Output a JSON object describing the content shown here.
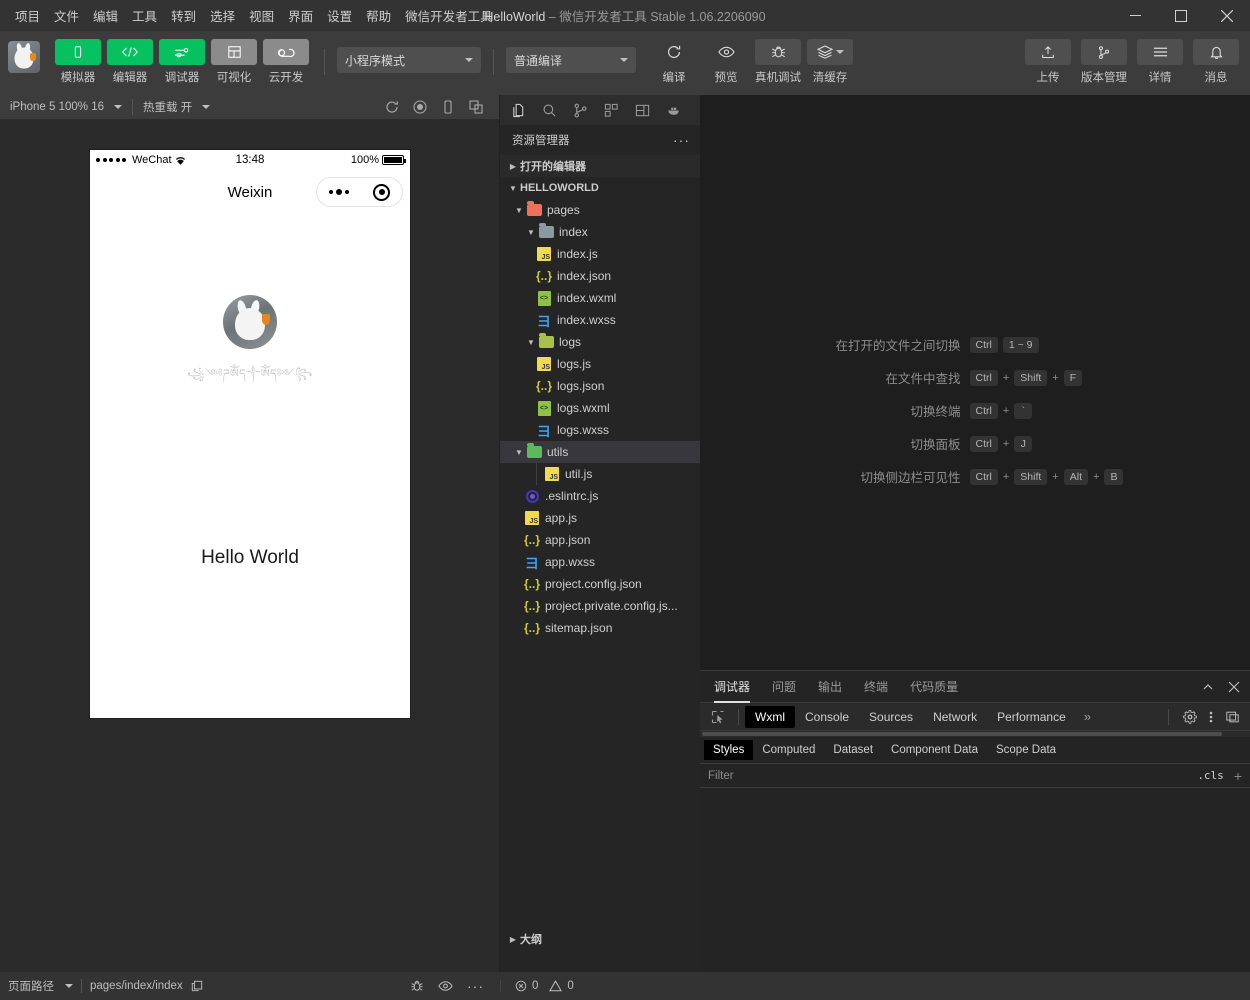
{
  "window": {
    "title": "HelloWorld",
    "dash": "–",
    "subtitle": "微信开发者工具 Stable 1.06.2206090",
    "minimize_icon": "minimize-icon",
    "maximize_icon": "maximize-icon",
    "close_icon": "close-icon"
  },
  "menu": [
    "项目",
    "文件",
    "编辑",
    "工具",
    "转到",
    "选择",
    "视图",
    "界面",
    "设置",
    "帮助",
    "微信开发者工具"
  ],
  "toolbar": {
    "avatar_name": "project-avatar",
    "modes": [
      {
        "label": "模拟器",
        "icon": "phone-icon",
        "active": true
      },
      {
        "label": "编辑器",
        "icon": "code-icon",
        "active": true
      },
      {
        "label": "调试器",
        "icon": "sliders-icon",
        "active": true
      },
      {
        "label": "可视化",
        "icon": "layout-icon",
        "active": false
      },
      {
        "label": "云开发",
        "icon": "cloud-icon",
        "active": false
      }
    ],
    "project_mode": "小程序模式",
    "compile_mode": "普通编译",
    "actions": [
      {
        "label": "编译",
        "icon": "refresh-icon"
      },
      {
        "label": "预览",
        "icon": "eye-icon"
      },
      {
        "label": "真机调试",
        "icon": "bug-icon"
      },
      {
        "label": "清缓存",
        "icon": "layers-icon"
      }
    ],
    "right_actions": [
      {
        "label": "上传",
        "icon": "upload-icon"
      },
      {
        "label": "版本管理",
        "icon": "branch-icon"
      },
      {
        "label": "详情",
        "icon": "menu-icon"
      },
      {
        "label": "消息",
        "icon": "bell-icon"
      }
    ]
  },
  "simulator": {
    "device": "iPhone 5 100% 16",
    "hot_reload": "热重载 开",
    "icons": [
      "refresh-icon",
      "record-icon",
      "rotate-icon",
      "multi-window-icon"
    ],
    "phone": {
      "carrier": "WeChat",
      "time": "13:48",
      "battery_pct": "100%",
      "nav_title": "Weixin",
      "capsule_more_icon": "more-dots-icon",
      "capsule_target_icon": "target-icon",
      "user_name": "꧁༺ཌༀད༒ༀད༻꧂",
      "hello_text": "Hello World"
    }
  },
  "activity_bar": [
    {
      "name": "files-icon",
      "active": true
    },
    {
      "name": "search-icon",
      "active": false
    },
    {
      "name": "source-control-icon",
      "active": false
    },
    {
      "name": "extensions-icon",
      "active": false
    },
    {
      "name": "layout-icon",
      "active": false
    },
    {
      "name": "docker-icon",
      "active": false
    }
  ],
  "explorer": {
    "title": "资源管理器",
    "more_icon": "more-horizontal-icon",
    "open_editors": "打开的编辑器",
    "project_root": "HELLOWORLD",
    "outline": "大纲",
    "tree": [
      {
        "label": "pages",
        "type": "folder",
        "indent": 1,
        "open": true,
        "color": "#f0705a",
        "selected": false
      },
      {
        "label": "index",
        "type": "folder",
        "indent": 2,
        "open": true,
        "color": "#8a9aa0",
        "selected": false
      },
      {
        "label": "index.js",
        "type": "js",
        "indent": 3,
        "selected": false
      },
      {
        "label": "index.json",
        "type": "json",
        "indent": 3,
        "selected": false
      },
      {
        "label": "index.wxml",
        "type": "wxml",
        "indent": 3,
        "selected": false
      },
      {
        "label": "index.wxss",
        "type": "wxss",
        "indent": 3,
        "selected": false
      },
      {
        "label": "logs",
        "type": "folder",
        "indent": 2,
        "open": true,
        "color": "#a8c14a",
        "selected": false
      },
      {
        "label": "logs.js",
        "type": "js",
        "indent": 3,
        "selected": false
      },
      {
        "label": "logs.json",
        "type": "json",
        "indent": 3,
        "selected": false
      },
      {
        "label": "logs.wxml",
        "type": "wxml",
        "indent": 3,
        "selected": false
      },
      {
        "label": "logs.wxss",
        "type": "wxss",
        "indent": 3,
        "selected": false
      },
      {
        "label": "utils",
        "type": "folder",
        "indent": 1,
        "open": true,
        "color": "#5eb95e",
        "selected": true
      },
      {
        "label": "util.js",
        "type": "js",
        "indent": 3,
        "guide": true,
        "selected": false
      },
      {
        "label": ".eslintrc.js",
        "type": "eslint",
        "indent": 2,
        "selected": false
      },
      {
        "label": "app.js",
        "type": "js",
        "indent": 2,
        "selected": false
      },
      {
        "label": "app.json",
        "type": "json",
        "indent": 2,
        "selected": false
      },
      {
        "label": "app.wxss",
        "type": "wxss",
        "indent": 2,
        "selected": false
      },
      {
        "label": "project.config.json",
        "type": "json",
        "indent": 2,
        "selected": false
      },
      {
        "label": "project.private.config.js...",
        "type": "json",
        "indent": 2,
        "selected": false
      },
      {
        "label": "sitemap.json",
        "type": "json",
        "indent": 2,
        "selected": false
      }
    ]
  },
  "editor_hints": [
    {
      "label": "在打开的文件之间切换",
      "keys": [
        "Ctrl",
        "1 ~ 9"
      ],
      "seps": []
    },
    {
      "label": "在文件中查找",
      "keys": [
        "Ctrl",
        "Shift",
        "F"
      ],
      "seps": [
        "+",
        "+"
      ]
    },
    {
      "label": "切换终端",
      "keys": [
        "Ctrl",
        "`"
      ],
      "seps": [
        "+"
      ]
    },
    {
      "label": "切换面板",
      "keys": [
        "Ctrl",
        "J"
      ],
      "seps": [
        "+"
      ]
    },
    {
      "label": "切换侧边栏可见性",
      "keys": [
        "Ctrl",
        "Shift",
        "Alt",
        "B"
      ],
      "seps": [
        "+",
        "+",
        "+"
      ]
    }
  ],
  "devpanel": {
    "panel_tabs": [
      {
        "label": "调试器",
        "active": true
      },
      {
        "label": "问题",
        "active": false
      },
      {
        "label": "输出",
        "active": false
      },
      {
        "label": "终端",
        "active": false
      },
      {
        "label": "代码质量",
        "active": false
      }
    ],
    "collapse_icon": "chevron-up-icon",
    "close_icon": "close-icon",
    "picker_icon": "element-picker-icon",
    "devtool_tabs": [
      {
        "label": "Wxml",
        "active": true
      },
      {
        "label": "Console",
        "active": false
      },
      {
        "label": "Sources",
        "active": false
      },
      {
        "label": "Network",
        "active": false
      },
      {
        "label": "Performance",
        "active": false
      }
    ],
    "more_tabs_icon": "chevron-double-right-icon",
    "settings_icon": "gear-icon",
    "kebab_icon": "kebab-menu-icon",
    "dock_icon": "dock-side-icon",
    "styles_tabs": [
      {
        "label": "Styles",
        "active": true
      },
      {
        "label": "Computed",
        "active": false
      },
      {
        "label": "Dataset",
        "active": false
      },
      {
        "label": "Component Data",
        "active": false
      },
      {
        "label": "Scope Data",
        "active": false
      }
    ],
    "filter_placeholder": "Filter",
    "cls_label": ".cls",
    "add_icon": "plus-icon"
  },
  "statusbar": {
    "page_path_label": "页面路径",
    "page_path_value": "pages/index/index",
    "copy_icon": "copy-icon",
    "bug_icon": "bug-icon",
    "eye_icon": "eye-icon",
    "more_icon": "more-horizontal-icon",
    "errors": "0",
    "warnings": "0"
  },
  "colors": {
    "accent_green": "#07c160",
    "titlebar_bg": "#333333",
    "toolbar_bg": "#3c3c3c",
    "explorer_bg": "#252526",
    "editor_bg": "#1e1e1e",
    "selection_bg": "#37373d"
  }
}
